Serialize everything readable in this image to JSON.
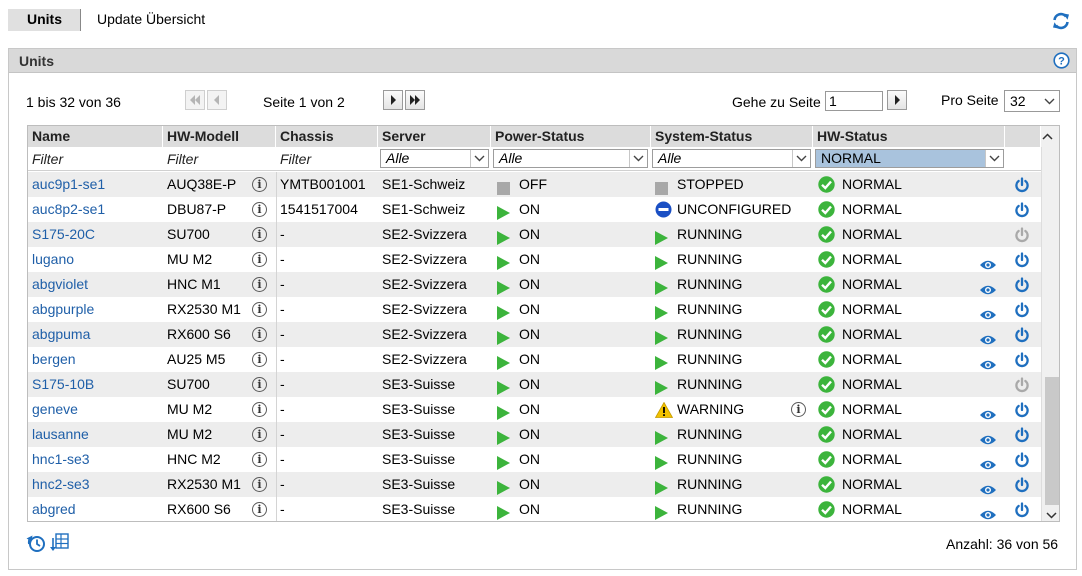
{
  "tabs": [
    {
      "label": "Units"
    },
    {
      "label": "Update Übersicht"
    }
  ],
  "panel": {
    "title": "Units"
  },
  "pager": {
    "range": "1 bis 32 von 36",
    "page": "Seite 1 von 2",
    "goto_label": "Gehe zu Seite",
    "goto_value": "1",
    "per_page_label": "Pro Seite",
    "per_page_value": "32"
  },
  "columns": [
    "Name",
    "HW-Modell",
    "Chassis",
    "Server",
    "Power-Status",
    "System-Status",
    "HW-Status"
  ],
  "filters": {
    "name": "Filter",
    "model": "Filter",
    "chassis": "Filter",
    "server": "Alle",
    "power": "Alle",
    "system": "Alle",
    "hw": "NORMAL"
  },
  "rows": [
    {
      "name": "auc9p1-se1",
      "model": "AUQ38E-P",
      "chassis": "YMTB001001",
      "server": "SE1-Schweiz",
      "power": "OFF",
      "system": "STOPPED",
      "hw": "NORMAL",
      "eye": false,
      "power_btn": "active"
    },
    {
      "name": "auc8p2-se1",
      "model": "DBU87-P",
      "chassis": "1541517004",
      "server": "SE1-Schweiz",
      "power": "ON",
      "system": "UNCONFIGURED",
      "hw": "NORMAL",
      "eye": false,
      "power_btn": "active"
    },
    {
      "name": "S175-20C",
      "model": "SU700",
      "chassis": "-",
      "server": "SE2-Svizzera",
      "power": "ON",
      "system": "RUNNING",
      "hw": "NORMAL",
      "eye": false,
      "power_btn": "disabled"
    },
    {
      "name": "lugano",
      "model": "MU M2",
      "chassis": "-",
      "server": "SE2-Svizzera",
      "power": "ON",
      "system": "RUNNING",
      "hw": "NORMAL",
      "eye": true,
      "power_btn": "active"
    },
    {
      "name": "abgviolet",
      "model": "HNC M1",
      "chassis": "-",
      "server": "SE2-Svizzera",
      "power": "ON",
      "system": "RUNNING",
      "hw": "NORMAL",
      "eye": true,
      "power_btn": "active"
    },
    {
      "name": "abgpurple",
      "model": "RX2530 M1",
      "chassis": "-",
      "server": "SE2-Svizzera",
      "power": "ON",
      "system": "RUNNING",
      "hw": "NORMAL",
      "eye": true,
      "power_btn": "active"
    },
    {
      "name": "abgpuma",
      "model": "RX600 S6",
      "chassis": "-",
      "server": "SE2-Svizzera",
      "power": "ON",
      "system": "RUNNING",
      "hw": "NORMAL",
      "eye": true,
      "power_btn": "active"
    },
    {
      "name": "bergen",
      "model": "AU25 M5",
      "chassis": "-",
      "server": "SE2-Svizzera",
      "power": "ON",
      "system": "RUNNING",
      "hw": "NORMAL",
      "eye": true,
      "power_btn": "active"
    },
    {
      "name": "S175-10B",
      "model": "SU700",
      "chassis": "-",
      "server": "SE3-Suisse",
      "power": "ON",
      "system": "RUNNING",
      "hw": "NORMAL",
      "eye": false,
      "power_btn": "disabled"
    },
    {
      "name": "geneve",
      "model": "MU M2",
      "chassis": "-",
      "server": "SE3-Suisse",
      "power": "ON",
      "system": "WARNING",
      "hw": "NORMAL",
      "eye": true,
      "power_btn": "active"
    },
    {
      "name": "lausanne",
      "model": "MU M2",
      "chassis": "-",
      "server": "SE3-Suisse",
      "power": "ON",
      "system": "RUNNING",
      "hw": "NORMAL",
      "eye": true,
      "power_btn": "active"
    },
    {
      "name": "hnc1-se3",
      "model": "HNC M2",
      "chassis": "-",
      "server": "SE3-Suisse",
      "power": "ON",
      "system": "RUNNING",
      "hw": "NORMAL",
      "eye": true,
      "power_btn": "active"
    },
    {
      "name": "hnc2-se3",
      "model": "RX2530 M1",
      "chassis": "-",
      "server": "SE3-Suisse",
      "power": "ON",
      "system": "RUNNING",
      "hw": "NORMAL",
      "eye": true,
      "power_btn": "active"
    },
    {
      "name": "abgred",
      "model": "RX600 S6",
      "chassis": "-",
      "server": "SE3-Suisse",
      "power": "ON",
      "system": "RUNNING",
      "hw": "NORMAL",
      "eye": true,
      "power_btn": "active"
    }
  ],
  "footer": {
    "count": "Anzahl: 36 von 56"
  },
  "colors": {
    "link": "#1f5fa8",
    "green": "#3cb43c",
    "icon_blue": "#1f6fbf",
    "gray": "#a8a8a8"
  }
}
